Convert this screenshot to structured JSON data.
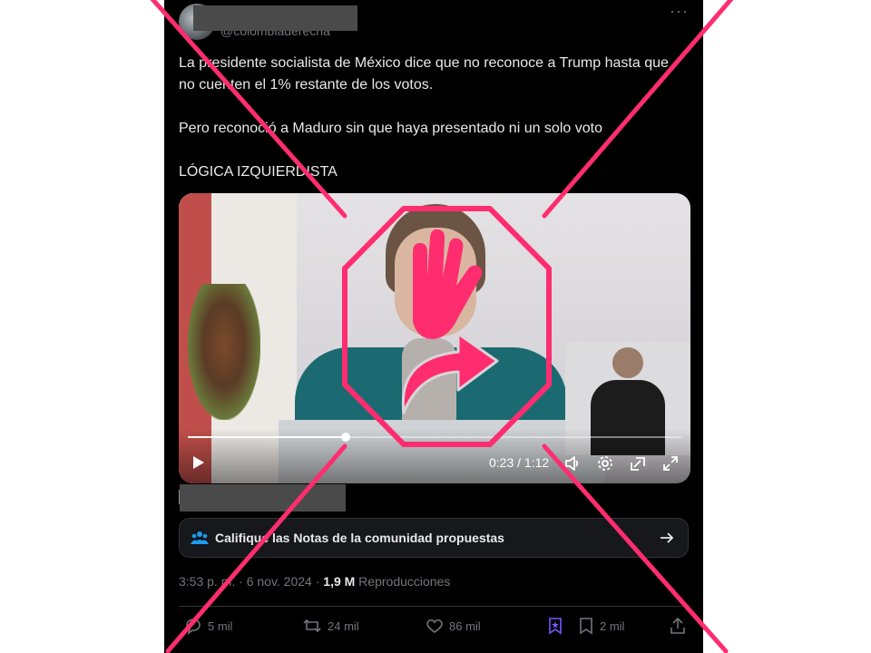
{
  "post": {
    "handle": "@colombiaderecha",
    "more_label": "···",
    "paragraphs": [
      "La presidente socialista de México dice que no reconoce a Trump hasta que no cuenten el 1% restante de los votos.",
      "Pero reconoció a Maduro sin que haya presentado ni un solo voto",
      "LÓGICA IZQUIERDISTA"
    ]
  },
  "video": {
    "time": "0:23 / 1:12",
    "progress": 0.32
  },
  "community_notes": {
    "label": "Califique las Notas de la comunidad propuestas"
  },
  "meta": {
    "timestamp": "3:53 p. m. · 6 nov. 2024 · ",
    "views": "1,9 M",
    "views_label": " Reproducciones"
  },
  "actions": {
    "replies": "5 mil",
    "reposts": "24 mil",
    "likes": "86 mil",
    "bookmarks": "2 mil"
  },
  "colors": {
    "background": "#000000",
    "overlay_pink": "#ff2d6f",
    "muted": "#71767b"
  },
  "icons": [
    "play-icon",
    "volume-icon",
    "settings-icon",
    "pip-icon",
    "fullscreen-icon",
    "community-icon",
    "arrow-right-icon",
    "reply-icon",
    "repost-icon",
    "like-icon",
    "grok-icon",
    "bookmark-icon",
    "share-icon",
    "stop-hand-icon"
  ]
}
